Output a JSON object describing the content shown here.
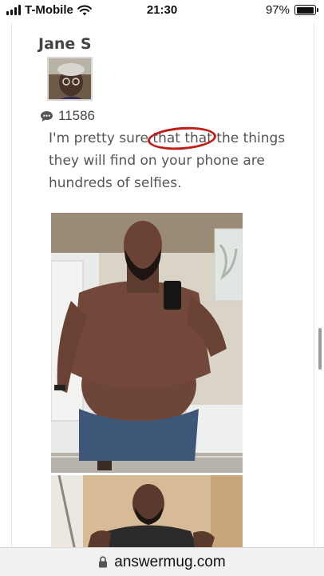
{
  "status_bar": {
    "carrier": "T-Mobile",
    "time": "21:30",
    "battery_percent": "97%",
    "battery_level": 0.97,
    "icons": [
      "signal-icon",
      "wifi-icon",
      "battery-icon"
    ]
  },
  "post": {
    "author": "Jane S",
    "comment_icon": "comment-bubble-icon",
    "comment_count": "11586",
    "text_before": "I'm pretty sure ",
    "text_highlight": "that that",
    "text_after": " the things they will find  on your phone are hundreds of selfies.",
    "highlight_color": "#c01d18"
  },
  "images": [
    {
      "name": "mirror-selfie-photo"
    },
    {
      "name": "second-selfie-photo"
    }
  ],
  "address_bar": {
    "lock_icon": "lock-icon",
    "url": "answermug.com"
  }
}
